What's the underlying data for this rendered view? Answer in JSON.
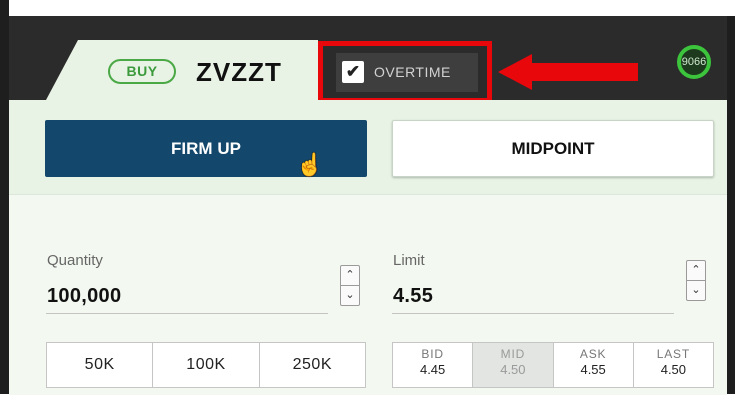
{
  "order": {
    "side": "BUY",
    "symbol": "ZVZZT",
    "badge_text": "9066"
  },
  "overtime": {
    "label": "OVERTIME",
    "checked": true
  },
  "actions": {
    "firm_up_label": "FIRM UP",
    "midpoint_label": "MIDPOINT"
  },
  "quantity": {
    "label": "Quantity",
    "value": "100,000"
  },
  "limit": {
    "label": "Limit",
    "value": "4.55"
  },
  "quick_sizes": [
    "50K",
    "100K",
    "250K"
  ],
  "quotes": [
    {
      "label": "BID",
      "value": "4.45",
      "active": false
    },
    {
      "label": "MID",
      "value": "4.50",
      "active": true
    },
    {
      "label": "ASK",
      "value": "4.55",
      "active": false
    },
    {
      "label": "LAST",
      "value": "4.50",
      "active": false
    }
  ],
  "icons": {
    "checkbox": "check-icon",
    "stepper_up": "chevron-up-icon",
    "stepper_down": "chevron-down-icon",
    "cursor": "hand-cursor-icon",
    "annotation": "red-arrow-icon"
  },
  "colors": {
    "primary_button": "#13476b",
    "buy_accent": "#3c9a3c",
    "annotation": "#e8070b",
    "panel_bg": "#e8f3e5"
  }
}
